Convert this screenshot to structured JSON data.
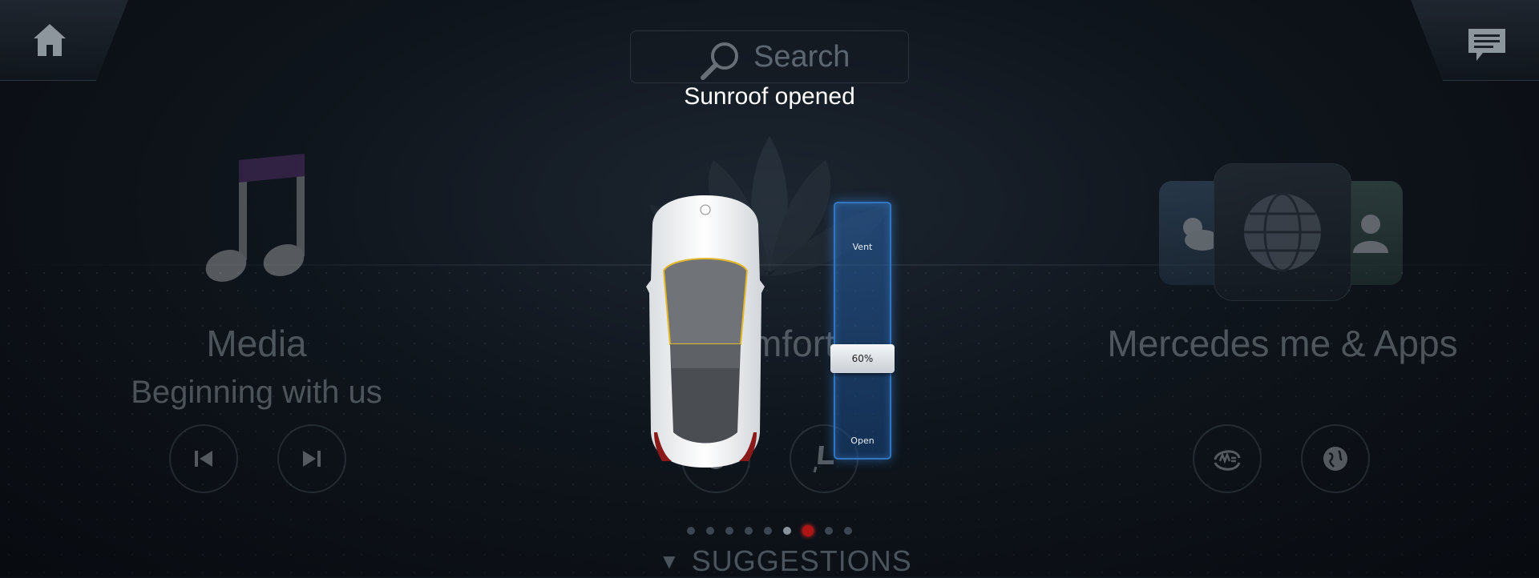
{
  "header": {
    "home_icon": "home-icon",
    "messages_icon": "chat-icon",
    "search_label": "Search"
  },
  "toast": "Sunroof opened",
  "tiles": {
    "media": {
      "title": "Media",
      "subtitle": "Beginning with us",
      "buttons": [
        "skip-previous-icon",
        "skip-next-icon"
      ]
    },
    "comfort": {
      "title": "Comfort",
      "buttons": [
        "media-play-icon",
        "seat-icon"
      ]
    },
    "apps": {
      "title": "Mercedes me & Apps",
      "buttons": [
        "mercedes-me-icon",
        "globe-icon"
      ]
    }
  },
  "sunroof": {
    "top_label": "Vent",
    "bottom_label": "Open",
    "value_label": "60%",
    "value": 0.6
  },
  "pagination": {
    "count": 9,
    "active": 6
  },
  "suggestions_label": "SUGGESTIONS",
  "colors": {
    "accent_blue": "#2f77c4",
    "active_dot": "#b01515"
  }
}
